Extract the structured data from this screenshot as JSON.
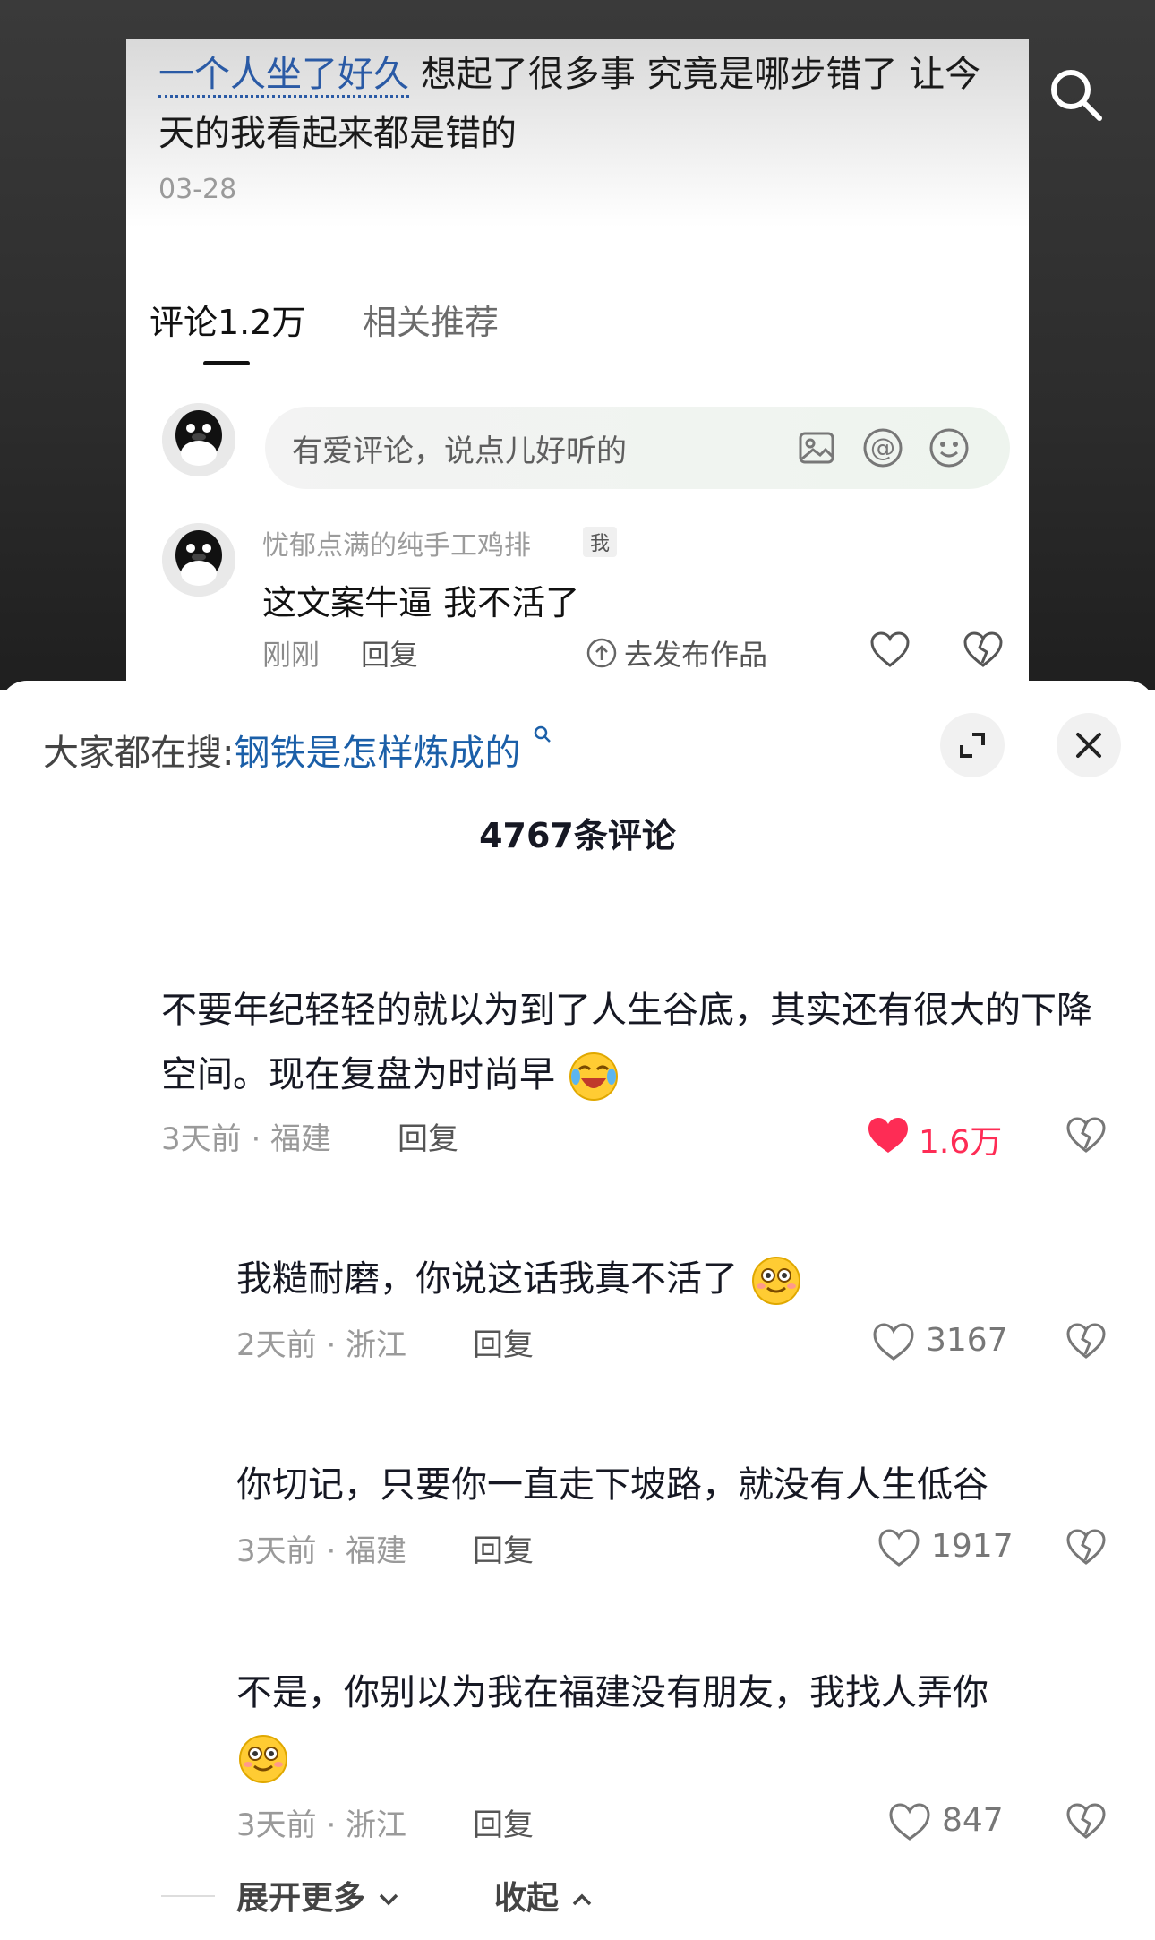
{
  "post": {
    "text_highlight": "一个人坐了好久",
    "text_rest": " 想起了很多事 究竟是哪步错了 让今天的我看起来都是错的",
    "date": "03-28"
  },
  "tabs": {
    "comments": "评论1.2万",
    "related": "相关推荐"
  },
  "input": {
    "placeholder": "有爱评论，说点儿好听的"
  },
  "my_comment": {
    "name": "忧郁点满的纯手工鸡排",
    "badge": "我",
    "text": "这文案牛逼 我不活了",
    "time": "刚刚",
    "reply": "回复",
    "publish": "去发布作品"
  },
  "sheet": {
    "search_label": "大家都在搜:",
    "search_keyword": "钢铁是怎样炼成的",
    "comment_count": "4767条评论"
  },
  "comments": [
    {
      "text": "不要年纪轻轻的就以为到了人生谷底，其实还有很大的下降空间。现在复盘为时尚早",
      "meta": "3天前 · 福建",
      "reply": "回复",
      "likes": "1.6万",
      "liked": true,
      "emoji": "crying-laugh"
    },
    {
      "text": "我糙耐磨，你说这话我真不活了",
      "meta": "2天前 · 浙江",
      "reply": "回复",
      "likes": "3167",
      "liked": false,
      "emoji": "smile"
    },
    {
      "text": "你切记，只要你一直走下坡路，就没有人生低谷",
      "meta": "3天前 · 福建",
      "reply": "回复",
      "likes": "1917",
      "liked": false
    },
    {
      "text": "不是，你别以为我在福建没有朋友，我找人弄你",
      "meta": "3天前 · 浙江",
      "reply": "回复",
      "likes": "847",
      "liked": false,
      "emoji": "smile"
    }
  ],
  "footer": {
    "expand": "展开更多",
    "collapse": "收起"
  },
  "colors": {
    "accent": "#1b5fa8",
    "like": "#fe2c55"
  }
}
